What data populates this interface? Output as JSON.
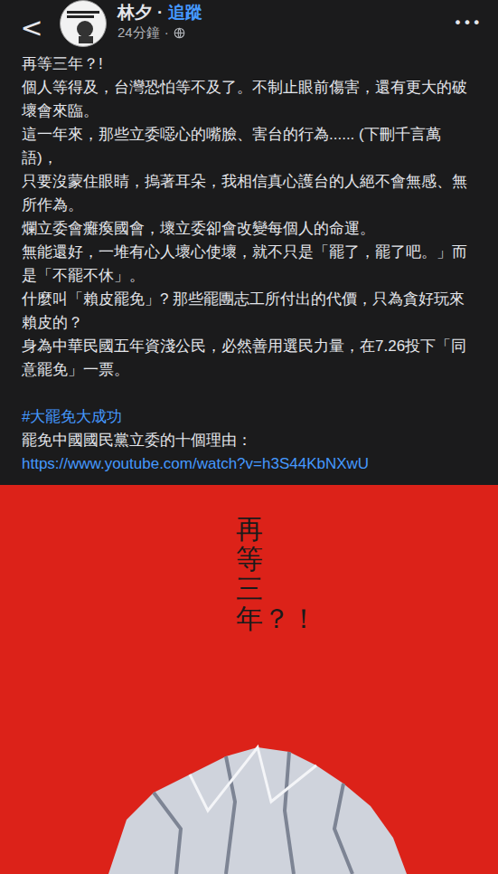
{
  "post": {
    "author": "林夕",
    "separator": "·",
    "follow": "追蹤",
    "time": "24分鐘",
    "time_separator": "·",
    "menu": "•••",
    "back": "<"
  },
  "body": {
    "paragraphs": [
      "再等三年？!",
      "個人等得及，台灣恐怕等不及了。不制止眼前傷害，還有更大的破壞會來臨。",
      "這一年來，那些立委噁心的嘴臉、害台的行為......  (下刪千言萬語)，",
      "只要沒蒙住眼睛，摀著耳朵，我相信真心護台的人絕不會無感、無所作為。",
      "爛立委會癱瘓國會，壞立委卻會改變每個人的命運。",
      "無能還好，一堆有心人壞心使壞，就不只是「罷了，罷了吧。」而是「不罷不休」。",
      "什麼叫「賴皮罷免」? 那些罷團志工所付出的代價，只為貪好玩來賴皮的？",
      "身為中華民國五年資淺公民，必然善用選民力量，在7.26投下「同意罷免」一票。"
    ],
    "hashtag": "#大罷免大成功",
    "link_label": "罷免中國國民黨立委的十個理由：",
    "link": "https://www.youtube.com/watch?v=h3S44KbNXwU"
  },
  "image": {
    "caption": "再等三年？！"
  }
}
